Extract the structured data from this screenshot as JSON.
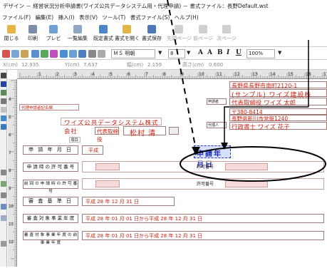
{
  "window": {
    "title": "デザイン － 経営状況分析申請書(ワイズ公共データシステム用・代理申請) － 書式ファイル：長野Default.wst"
  },
  "menu": [
    "ファイル(F)",
    "編集(E)",
    "挿入(I)",
    "表示(V)",
    "ツール(T)",
    "書式ファイル(S)",
    "ヘルプ(H)"
  ],
  "toolbar": {
    "buttons": [
      {
        "label": "閉じる",
        "icon": "close-doc-icon",
        "enabled": true
      },
      {
        "label": "印刷",
        "icon": "print-icon",
        "enabled": true
      },
      {
        "label": "プレビ",
        "icon": "preview-icon",
        "enabled": true
      },
      {
        "label": "一覧編集",
        "icon": "list-edit-icon",
        "enabled": true
      },
      {
        "label": "既定書式",
        "icon": "default-format-icon",
        "enabled": true
      },
      {
        "label": "書式を開く",
        "icon": "open-format-icon",
        "enabled": true
      },
      {
        "label": "書式保存",
        "icon": "save-format-icon",
        "enabled": true
      },
      {
        "label": "先頭ページ",
        "icon": "first-page-icon",
        "enabled": false
      },
      {
        "label": "前ページ",
        "icon": "prev-page-icon",
        "enabled": false
      },
      {
        "label": "次ページ",
        "icon": "next-page-icon",
        "enabled": false
      }
    ]
  },
  "format_bar": {
    "font": "ＭＳ 明朝",
    "size": "8",
    "zoom": "100%"
  },
  "coords": {
    "x_label": "X(cm)",
    "x_value": "12.935",
    "y_label": "Y(cm)",
    "y_value": "7.637",
    "w_label": "幅(cm)",
    "w_value": "2.159",
    "h_label": "高さ(cm)",
    "h_value": "0.600"
  },
  "ruler_numbers": [
    "1",
    "2",
    "3",
    "4",
    "5",
    "6",
    "7",
    "8",
    "9",
    "10",
    "11",
    "12",
    "13",
    "14",
    "15",
    "16",
    "17"
  ],
  "vruler_numbers": [
    "4",
    "5",
    "6",
    "7",
    "8",
    "9",
    "10",
    "11",
    "12"
  ],
  "document": {
    "agent_header": "代理申請者記名欄",
    "applicant_lines": [
      "長野県長野市南町2120-1",
      "(サンプル) ワイズ建設株",
      "代表取締役 ワイズ 太郎",
      "〒380-8414",
      "長野県新川市常盤1240",
      "行政書士 ワイズ 花子"
    ],
    "labels_right": [
      "申請者",
      "代理人"
    ],
    "company": "ワイズ公共データシステム株式会社",
    "rep_title": "代表取締役",
    "rep_name": "松村 清",
    "heading": "項目",
    "rows": [
      {
        "label": "申 請 年 月 日",
        "value": "平成"
      },
      {
        "label": "申 請 時 の 許 可 番 号",
        "value": "許可番号"
      },
      {
        "label": "前 回 の 申 請 時 の 許 可 番 号",
        "value": "許可番号"
      },
      {
        "label": "審 査 基 準 日",
        "value": "平成 28 年 12 月 31 日"
      },
      {
        "label": "審 査 対 象 事 業 年 度",
        "value": "平成 28 年 01 月 01 日から平成 28 年 12 月 31 日"
      },
      {
        "label": "審 査 対 象 事 業 年 度 の 前 事 業 年 度",
        "value": "平成 28 年 01 月 01 日から平成 28 年 12 月 31 日"
      }
    ],
    "selected_field": "申請年月日"
  }
}
